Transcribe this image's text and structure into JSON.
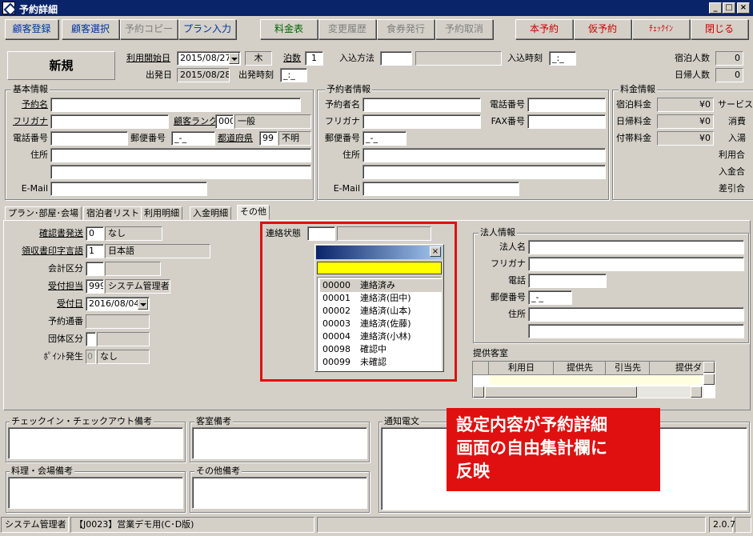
{
  "window": {
    "title": "予約詳細",
    "min": "_",
    "max": "□",
    "close": "×"
  },
  "toolbar": {
    "customer_register": "顧客登録",
    "customer_select": "顧客選択",
    "reservation_copy": "予約コピー",
    "plan_input": "プラン入力",
    "price_table": "料金表",
    "change_history": "変更履歴",
    "meal_ticket": "食券発行",
    "reservation_cancel": "予約取消",
    "main_reservation": "本予約",
    "tentative_reservation": "仮予約",
    "check_in": "ﾁｪｯｸｲﾝ",
    "close": "閉じる"
  },
  "header": {
    "status": "新規",
    "start_date_label": "利用開始日",
    "start_date": "2015/08/27",
    "weekday": "木",
    "nights_label": "泊数",
    "nights": "1",
    "entry_method_label": "入込方法",
    "entry_method": "",
    "entry_time_label": "入込時刻",
    "entry_time": "_:_",
    "departure_label": "出発日",
    "departure": "2015/08/28",
    "departure_time_label": "出発時刻",
    "departure_time": "_:_",
    "stay_count_label": "宿泊人数",
    "stay_count": "0",
    "day_count_label": "日帰人数",
    "day_count": "0"
  },
  "basic": {
    "title": "基本情報",
    "name_label": "予約名",
    "kana_label": "フリガナ",
    "rank_label": "顧客ランク",
    "rank_code": "000",
    "rank_name": "一般",
    "phone_label": "電話番号",
    "zip_label": "郵便番号",
    "zip": "_-_",
    "pref_label": "都道府県",
    "pref_code": "99",
    "pref_name": "不明",
    "address_label": "住所",
    "email_label": "E-Mail"
  },
  "booker": {
    "title": "予約者情報",
    "name_label": "予約者名",
    "phone_label": "電話番号",
    "kana_label": "フリガナ",
    "fax_label": "FAX番号",
    "zip_label": "郵便番号",
    "zip": "_-_",
    "address_label": "住所",
    "email_label": "E-Mail"
  },
  "fees": {
    "title": "料金情報",
    "stay_label": "宿泊料金",
    "stay": "¥0",
    "day_label": "日帰料金",
    "day": "¥0",
    "extra_label": "付帯料金",
    "extra": "¥0",
    "service_label": "サービス",
    "tax_label": "消費",
    "bath_label": "入湯",
    "total_label": "利用合",
    "deposit_label": "入金合",
    "balance_label": "差引合"
  },
  "tabs": [
    "プラン･部屋･会場",
    "宿泊者リスト",
    "利用明細",
    "入金明細",
    "その他"
  ],
  "other": {
    "confirm_label": "確認書発送",
    "confirm_code": "0",
    "confirm_name": "なし",
    "receipt_lang_label": "領収書印字言語",
    "receipt_lang_code": "1",
    "receipt_lang_name": "日本語",
    "account_label": "会計区分",
    "reception_label": "受付担当",
    "reception_code": "999",
    "reception_name": "システム管理者",
    "received_date_label": "受付日",
    "received_date": "2016/08/04",
    "reservation_no_label": "予約通番",
    "group_label": "団体区分",
    "points_label": "ﾎﾟｲﾝﾄ発生",
    "points_code": "0",
    "points_name": "なし",
    "contact_label": "連絡状態"
  },
  "popup": {
    "close": "×",
    "items": [
      {
        "code": "00000",
        "name": "連絡済み"
      },
      {
        "code": "00001",
        "name": "連絡済(田中)"
      },
      {
        "code": "00002",
        "name": "連絡済(山本)"
      },
      {
        "code": "00003",
        "name": "連絡済(佐藤)"
      },
      {
        "code": "00004",
        "name": "連絡済(小林)"
      },
      {
        "code": "00098",
        "name": "確認中"
      },
      {
        "code": "00099",
        "name": "未確認"
      }
    ]
  },
  "corp": {
    "title": "法人情報",
    "name_label": "法人名",
    "kana_label": "フリガナ",
    "phone_label": "電話",
    "zip_label": "郵便番号",
    "zip": "_-_",
    "address_label": "住所"
  },
  "rooms": {
    "title": "提供客室",
    "columns": [
      "利用日",
      "提供先",
      "引当先",
      "提供ダ"
    ]
  },
  "memos": {
    "checkin": "チェックイン・チェックアウト備考",
    "room": "客室備考",
    "notify": "通知電文",
    "cuisine": "料理・会場備考",
    "other": "その他備考"
  },
  "callout": "設定内容が予約詳細\n画面の自由集計欄に\n反映",
  "colors": {
    "callout_bg": "#e01010",
    "highlight_border": "#e01010",
    "popup_input": "#ffff00"
  },
  "status": {
    "user": "システム管理者",
    "facility": "【J0023】営業デモ用(C･D版)",
    "version": "2.0.7"
  }
}
